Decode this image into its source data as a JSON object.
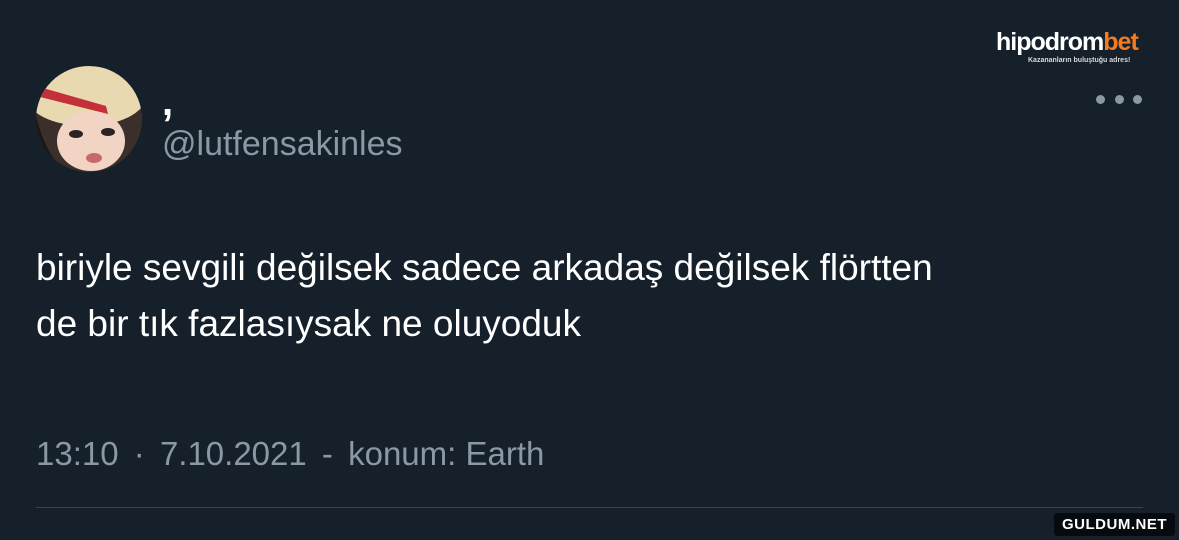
{
  "tweet": {
    "display_name": ",",
    "handle": "@lutfensakinles",
    "text": "biriyle sevgili değilsek sadece arkadaş değilsek flörtten\nde bir tık fazlasıysak ne oluyoduk",
    "time": "13:10",
    "date": "7.10.2021",
    "location": "konum: Earth"
  },
  "overlay": {
    "brand_part1": "hipodrom",
    "brand_part2": "bet",
    "brand_tagline": "Kazananların buluştuğu adres!",
    "watermark": "GULDUM.NET"
  },
  "colors": {
    "background": "#15202b",
    "secondary_text": "#8b98a5",
    "brand_accent": "#f47b20"
  },
  "icons": {
    "more": "more-horizontal-icon"
  }
}
